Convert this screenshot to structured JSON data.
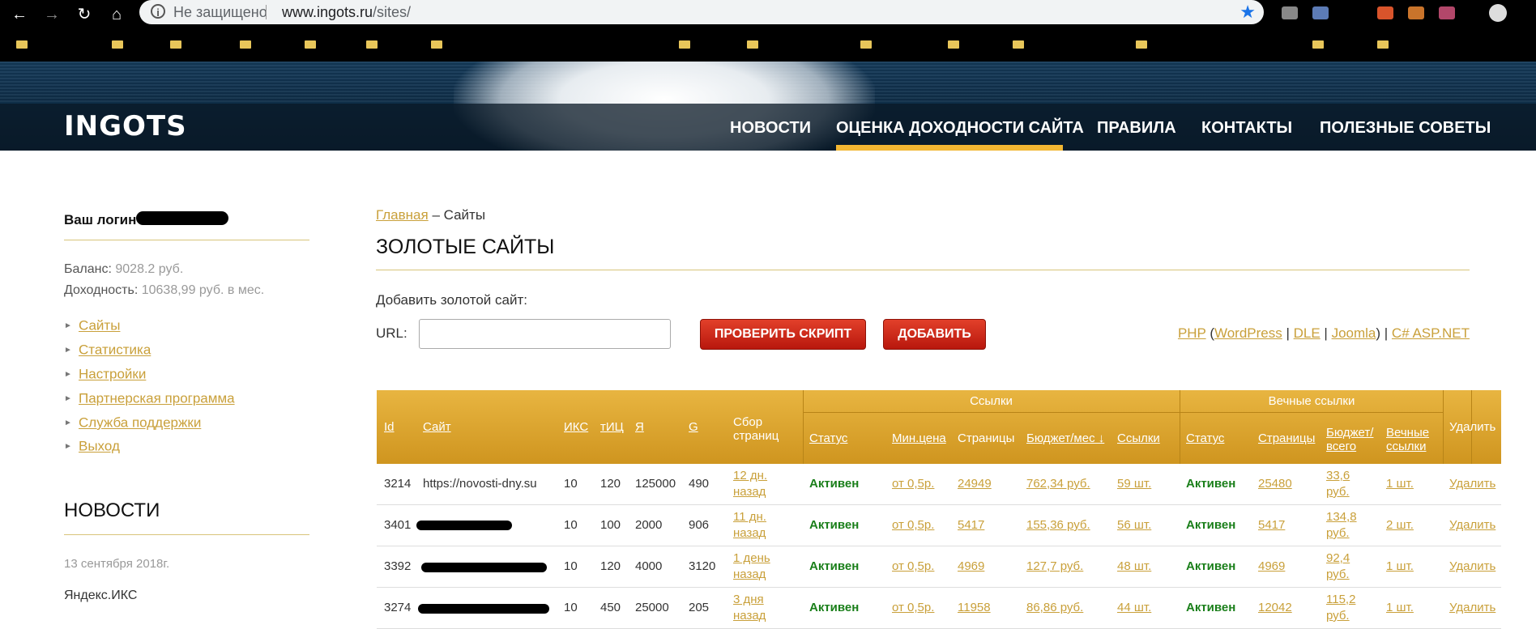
{
  "browser": {
    "security": "Не защищено",
    "url_host": "www.ingots.ru",
    "url_path": "/sites/"
  },
  "site": {
    "logo": "INGOTS",
    "menu": [
      "НОВОСТИ",
      "ОЦЕНКА ДОХОДНОСТИ САЙТА",
      "ПРАВИЛА",
      "КОНТАКТЫ",
      "ПОЛЕЗНЫЕ СОВЕТЫ"
    ],
    "accent": "#f2b632"
  },
  "sidebar": {
    "login_label": "Ваш логин",
    "balance_label": "Баланс:",
    "balance_value": "9028.2 руб.",
    "income_label": "Доходность:",
    "income_value": "10638,99 руб. в мес.",
    "items": [
      "Сайты",
      "Статистика",
      "Настройки",
      "Партнерская программа",
      "Служба поддержки",
      "Выход"
    ],
    "news_heading": "НОВОСТИ",
    "news_date": "13 сентября 2018г.",
    "news_title": "Яндекс.ИКС"
  },
  "main": {
    "crumb_home": "Главная",
    "crumb_sep": " – ",
    "crumb_current": "Сайты",
    "title": "ЗОЛОТЫЕ САЙТЫ",
    "add_label": "Добавить золотой сайт:",
    "url_label": "URL:",
    "url_value": "",
    "check_button": "ПРОВЕРИТЬ СКРИПТ",
    "add_button": "ДОБАВИТЬ",
    "links": {
      "php": "PHP",
      "open": " (",
      "wordpress": "WordPress",
      "s1": " | ",
      "dle": "DLE",
      "s2": " | ",
      "joomla": "Joomla",
      "close": ") | ",
      "asp": "C# ASP.NET"
    }
  },
  "table": {
    "group_links": "Ссылки",
    "group_eternal": "Вечные ссылки",
    "headers": {
      "id": "Id",
      "site": "Сайт",
      "iks": "ИКС",
      "tic": "тИЦ",
      "ya": "Я",
      "g": "G",
      "collect": "Сбор страниц",
      "status": "Статус",
      "min_price": "Мин.цена",
      "pages": "Страницы",
      "budget": "Бюджет/мес ↓",
      "links": "Ссылки",
      "e_status": "Статус",
      "e_pages": "Страницы",
      "e_budget": "Бюджет/ всего",
      "e_links": "Вечные ссылки",
      "delete": "Удалить"
    },
    "rows": [
      {
        "id": "3214",
        "site": "https://novosti-dny.su",
        "iks": "10",
        "tic": "120",
        "ya": "125000",
        "g": "490",
        "collect": "12 дн. назад",
        "status": "Активен",
        "min_price": "от 0,5р.",
        "pages": "24949",
        "budget": "762,34 руб.",
        "links": "59 шт.",
        "e_status": "Активен",
        "e_pages": "25480",
        "e_budget": "33,6 руб.",
        "e_links": "1 шт.",
        "delete": "Удалить"
      },
      {
        "id": "3401",
        "site": "",
        "iks": "10",
        "tic": "100",
        "ya": "2000",
        "g": "906",
        "collect": "11 дн. назад",
        "status": "Активен",
        "min_price": "от 0,5р.",
        "pages": "5417",
        "budget": "155,36 руб.",
        "links": "56 шт.",
        "e_status": "Активен",
        "e_pages": "5417",
        "e_budget": "134,8 руб.",
        "e_links": "2 шт.",
        "delete": "Удалить"
      },
      {
        "id": "3392",
        "site": "",
        "iks": "10",
        "tic": "120",
        "ya": "4000",
        "g": "3120",
        "collect": "1 день назад",
        "status": "Активен",
        "min_price": "от 0,5р.",
        "pages": "4969",
        "budget": "127,7 руб.",
        "links": "48 шт.",
        "e_status": "Активен",
        "e_pages": "4969",
        "e_budget": "92,4 руб.",
        "e_links": "1 шт.",
        "delete": "Удалить"
      },
      {
        "id": "3274",
        "site": "",
        "iks": "10",
        "tic": "450",
        "ya": "25000",
        "g": "205",
        "collect": "3 дня назад",
        "status": "Активен",
        "min_price": "от 0,5р.",
        "pages": "11958",
        "budget": "86,86 руб.",
        "links": "44 шт.",
        "e_status": "Активен",
        "e_pages": "12042",
        "e_budget": "115,2 руб.",
        "e_links": "1 шт.",
        "delete": "Удалить"
      }
    ]
  }
}
